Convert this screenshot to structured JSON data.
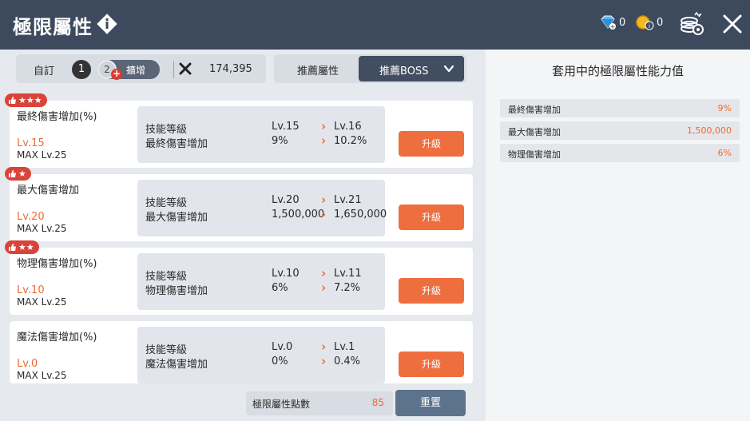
{
  "header": {
    "title": "極限屬性",
    "gem_count": "0",
    "coin_count": "0"
  },
  "toolbar": {
    "custom_label": "自訂",
    "slot1": "1",
    "slot2": "2",
    "expand_label": "擴增",
    "combat_power": "174,395",
    "recommend_label": "推薦屬性",
    "recommend_selected": "推薦BOSS"
  },
  "cards": [
    {
      "stars": "★★★",
      "name": "最終傷害增加(%)",
      "level": "Lv.15",
      "max": "MAX Lv.25",
      "skill_label": "技能等級",
      "effect_label": "最終傷害增加",
      "cur_lv": "Lv.15",
      "next_lv": "Lv.16",
      "cur_val": "9%",
      "next_val": "10.2%",
      "upgrade": "升級"
    },
    {
      "stars": "★",
      "name": "最大傷害增加",
      "level": "Lv.20",
      "max": "MAX Lv.25",
      "skill_label": "技能等級",
      "effect_label": "最大傷害增加",
      "cur_lv": "Lv.20",
      "next_lv": "Lv.21",
      "cur_val": "1,500,000",
      "next_val": "1,650,000",
      "upgrade": "升級"
    },
    {
      "stars": "★★",
      "name": "物理傷害增加(%)",
      "level": "Lv.10",
      "max": "MAX Lv.25",
      "skill_label": "技能等級",
      "effect_label": "物理傷害增加",
      "cur_lv": "Lv.10",
      "next_lv": "Lv.11",
      "cur_val": "6%",
      "next_val": "7.2%",
      "upgrade": "升級"
    },
    {
      "stars": "",
      "name": "魔法傷害增加(%)",
      "level": "Lv.0",
      "max": "MAX Lv.25",
      "skill_label": "技能等級",
      "effect_label": "魔法傷害增加",
      "cur_lv": "Lv.0",
      "next_lv": "Lv.1",
      "cur_val": "0%",
      "next_val": "0.4%",
      "upgrade": "升級"
    }
  ],
  "footer": {
    "points_label": "極限屬性點數",
    "points_value": "85",
    "reset_label": "重置"
  },
  "applied": {
    "title": "套用中的極限屬性能力值",
    "rows": [
      {
        "label": "最終傷害增加",
        "value": "9%"
      },
      {
        "label": "最大傷害增加",
        "value": "1,500,000"
      },
      {
        "label": "物理傷害增加",
        "value": "6%"
      }
    ]
  },
  "colors": {
    "header_bg": "#3d4a5e",
    "accent": "#ee6c35",
    "badge": "#d9443a",
    "reset_bg": "#5d738d"
  }
}
